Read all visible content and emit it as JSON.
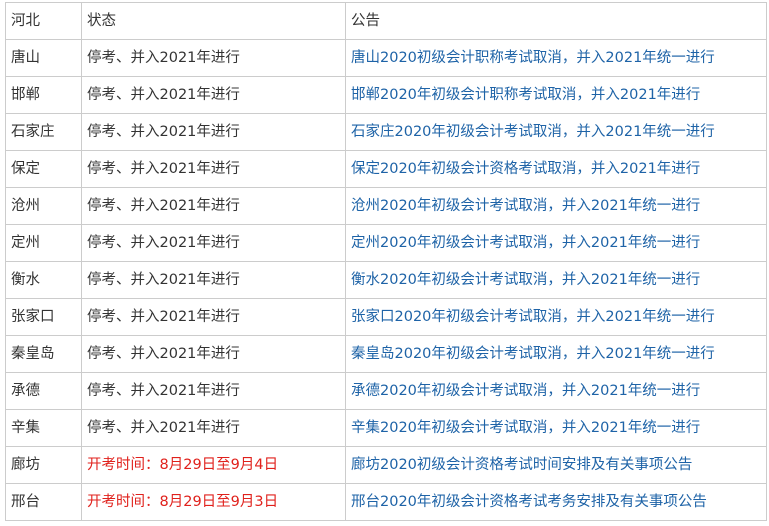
{
  "header": {
    "city": "河北",
    "status": "状态",
    "notice": "公告"
  },
  "colors": {
    "text": "#333333",
    "link": "#1e63a7",
    "alert": "#e0211c",
    "border": "#cccccc"
  },
  "rows": [
    {
      "city": "唐山",
      "status": "停考、并入2021年进行",
      "status_alert": false,
      "notice": "唐山2020初级会计职称考试取消，并入2021年统一进行"
    },
    {
      "city": "邯郸",
      "status": "停考、并入2021年进行",
      "status_alert": false,
      "notice": "邯郸2020年初级会计职称考试取消，并入2021年进行"
    },
    {
      "city": "石家庄",
      "status": "停考、并入2021年进行",
      "status_alert": false,
      "notice": "石家庄2020年初级会计考试取消，并入2021年统一进行"
    },
    {
      "city": "保定",
      "status": "停考、并入2021年进行",
      "status_alert": false,
      "notice": "保定2020年初级会计资格考试取消，并入2021年进行"
    },
    {
      "city": "沧州",
      "status": "停考、并入2021年进行",
      "status_alert": false,
      "notice": "沧州2020年初级会计考试取消，并入2021年统一进行"
    },
    {
      "city": "定州",
      "status": "停考、并入2021年进行",
      "status_alert": false,
      "notice": "定州2020年初级会计考试取消，并入2021年统一进行"
    },
    {
      "city": "衡水",
      "status": "停考、并入2021年进行",
      "status_alert": false,
      "notice": "衡水2020年初级会计考试取消，并入2021年统一进行"
    },
    {
      "city": "张家口",
      "status": "停考、并入2021年进行",
      "status_alert": false,
      "notice": "张家口2020年初级会计考试取消，并入2021年统一进行"
    },
    {
      "city": "秦皇岛",
      "status": "停考、并入2021年进行",
      "status_alert": false,
      "notice": "秦皇岛2020年初级会计考试取消，并入2021年统一进行"
    },
    {
      "city": "承德",
      "status": "停考、并入2021年进行",
      "status_alert": false,
      "notice": "承德2020年初级会计考试取消，并入2021年统一进行"
    },
    {
      "city": "辛集",
      "status": "停考、并入2021年进行",
      "status_alert": false,
      "notice": "辛集2020年初级会计考试取消，并入2021年统一进行"
    },
    {
      "city": "廊坊",
      "status": "开考时间：8月29日至9月4日",
      "status_alert": true,
      "notice": "廊坊2020初级会计资格考试时间安排及有关事项公告"
    },
    {
      "city": "邢台",
      "status": "开考时间：8月29日至9月3日",
      "status_alert": true,
      "notice": "邢台2020年初级会计资格考试考务安排及有关事项公告"
    }
  ]
}
